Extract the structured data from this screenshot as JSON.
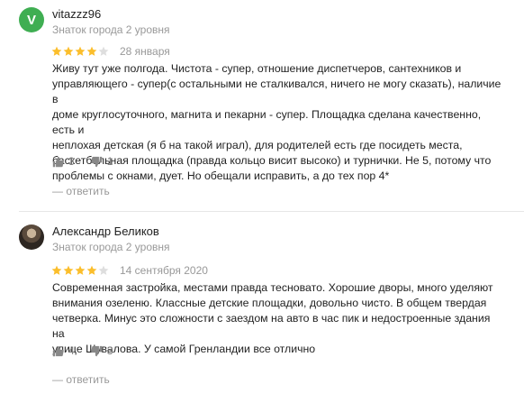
{
  "reviews": [
    {
      "avatar_letter": "V",
      "author": "vitazzz96",
      "level": "Знаток города 2 уровня",
      "rating": 4,
      "date": "28 января",
      "text": "Живу тут уже полгода. Чистота - супер, отношение диспетчеров, сантехников и\nуправляющего - супер(с остальными не сталкивался, ничего не могу сказать), наличие в\nдоме круглосуточного, магнита и пекарни - супер. Площадка сделана качественно, есть и\nнеплохая детская (я б на такой играл), для родителей есть где посидеть места,\nбаскетбольная площадка (правда кольцо висит высоко) и турнички. Не 5, потому что\nпроблемы с окнами, дует. Но обещали исправить, а до тех пор 4*",
      "likes": "3",
      "dislikes": "1",
      "answer_label": "— ответить"
    },
    {
      "avatar_letter": "",
      "author": "Александр Беликов",
      "level": "Знаток города 2 уровня",
      "rating": 4,
      "date": "14 сентября 2020",
      "text": "Современная застройка, местами правда тесновато. Хорошие дворы, много уделяют\nвнимания озеленю. Классные детские площадки, довольно чисто. В общем твердая\nчетверка. Минус это сложности с заездом на авто в час пик и недостроенные здания на\nулице Шувалова. У самой Гренландии все отлично",
      "likes": "4",
      "dislikes": "3",
      "answer_label": "— ответить"
    }
  ],
  "colors": {
    "star_filled": "#fbbe2c",
    "star_empty": "#dedede",
    "avatar_green": "#3fae52"
  }
}
